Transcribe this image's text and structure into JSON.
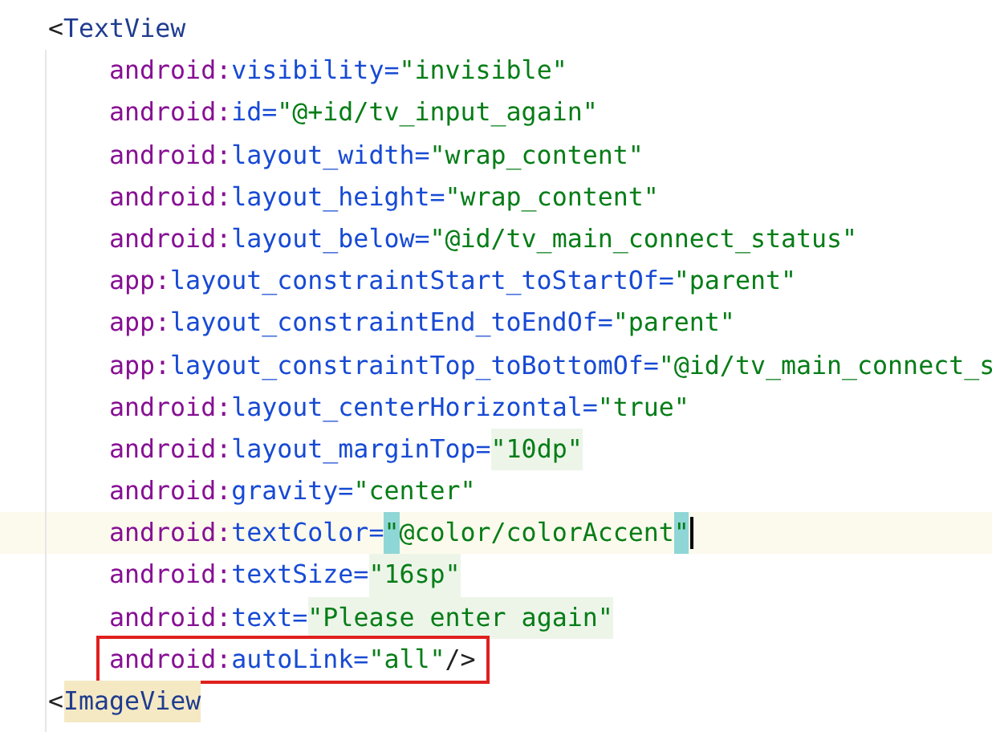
{
  "lines": [
    {
      "kind": "tag",
      "bracket": "<",
      "name": "TextView",
      "highlight": false
    },
    {
      "kind": "attr",
      "prefix": "android:",
      "name": "visibility=",
      "value": "\"invisible\""
    },
    {
      "kind": "attr",
      "prefix": "android:",
      "name": "id=",
      "value": "\"@+id/tv_input_again\""
    },
    {
      "kind": "attr",
      "prefix": "android:",
      "name": "layout_width=",
      "value": "\"wrap_content\""
    },
    {
      "kind": "attr",
      "prefix": "android:",
      "name": "layout_height=",
      "value": "\"wrap_content\""
    },
    {
      "kind": "attr",
      "prefix": "android:",
      "name": "layout_below=",
      "value": "\"@id/tv_main_connect_status\""
    },
    {
      "kind": "attr",
      "prefix": "app:",
      "name": "layout_constraintStart_toStartOf=",
      "value": "\"parent\""
    },
    {
      "kind": "attr",
      "prefix": "app:",
      "name": "layout_constraintEnd_toEndOf=",
      "value": "\"parent\""
    },
    {
      "kind": "attr",
      "prefix": "app:",
      "name": "layout_constraintTop_toBottomOf=",
      "value": "\"@id/tv_main_connect_s"
    },
    {
      "kind": "attr",
      "prefix": "android:",
      "name": "layout_centerHorizontal=",
      "value": "\"true\""
    },
    {
      "kind": "attr",
      "prefix": "android:",
      "name": "layout_marginTop=",
      "value": "\"10dp\"",
      "highlight": true
    },
    {
      "kind": "attr",
      "prefix": "android:",
      "name": "gravity=",
      "value": "\"center\""
    },
    {
      "kind": "attr",
      "prefix": "android:",
      "name": "textColor=",
      "value": "\"@color/colorAccent\"",
      "current": true,
      "quotes_matched": true
    },
    {
      "kind": "attr",
      "prefix": "android:",
      "name": "textSize=",
      "value": "\"16sp\"",
      "highlight": true
    },
    {
      "kind": "attr",
      "prefix": "android:",
      "name": "text=",
      "value": "\"Please enter again\"",
      "highlight": true
    },
    {
      "kind": "attr",
      "prefix": "android:",
      "name": "autoLink=",
      "value": "\"all\"",
      "closing": "/>",
      "boxed": true
    },
    {
      "kind": "tag",
      "bracket": "<",
      "name": "ImageView",
      "highlight": true
    }
  ]
}
